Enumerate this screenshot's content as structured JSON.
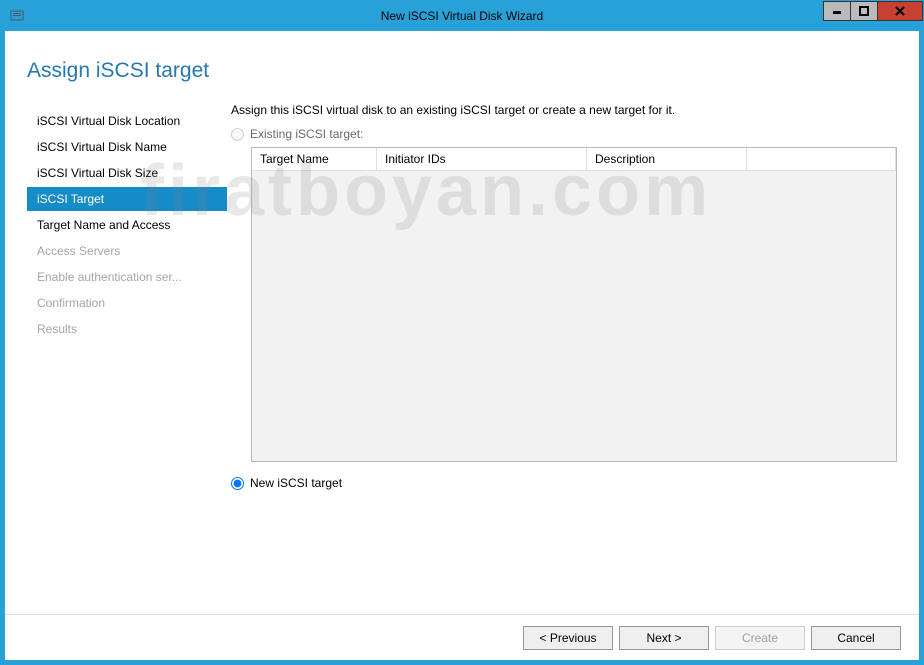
{
  "titlebar": {
    "title": "New iSCSI Virtual Disk Wizard"
  },
  "header": {
    "title": "Assign iSCSI target"
  },
  "sidebar": {
    "items": [
      {
        "label": "iSCSI Virtual Disk Location",
        "state": "completed"
      },
      {
        "label": "iSCSI Virtual Disk Name",
        "state": "completed"
      },
      {
        "label": "iSCSI Virtual Disk Size",
        "state": "completed"
      },
      {
        "label": "iSCSI Target",
        "state": "selected"
      },
      {
        "label": "Target Name and Access",
        "state": "completed"
      },
      {
        "label": "Access Servers",
        "state": "disabled"
      },
      {
        "label": "Enable authentication ser...",
        "state": "disabled"
      },
      {
        "label": "Confirmation",
        "state": "disabled"
      },
      {
        "label": "Results",
        "state": "disabled"
      }
    ]
  },
  "main": {
    "instruction": "Assign this iSCSI virtual disk to an existing iSCSI target or create a new target for it.",
    "radio_existing_label": "Existing iSCSI target:",
    "radio_new_label": "New iSCSI target",
    "table": {
      "col1": "Target Name",
      "col2": "Initiator IDs",
      "col3": "Description"
    }
  },
  "footer": {
    "previous": "< Previous",
    "next": "Next >",
    "create": "Create",
    "cancel": "Cancel"
  },
  "watermark": "firatboyan.com"
}
